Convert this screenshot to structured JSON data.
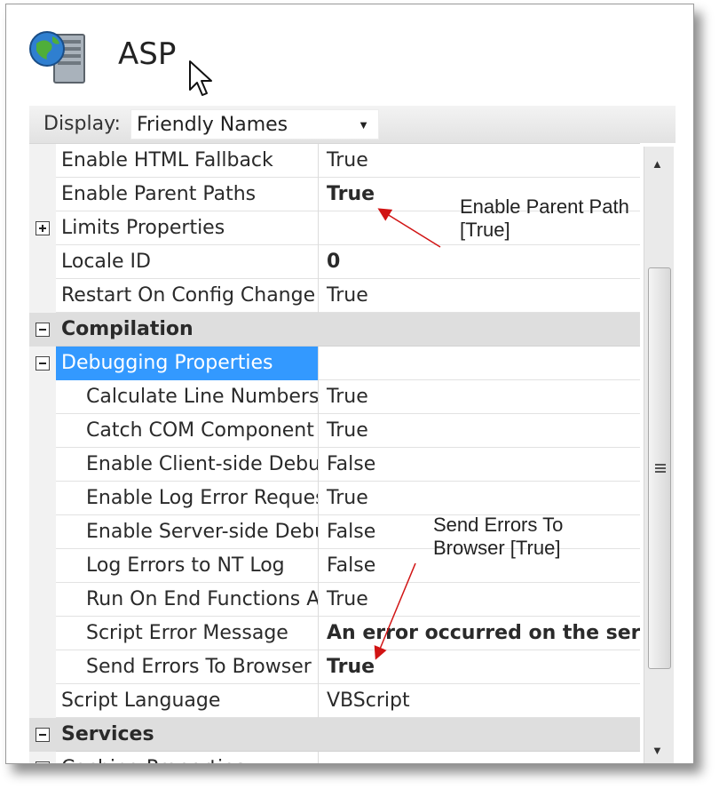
{
  "header": {
    "title": "ASP",
    "icon": "web-server-globe-icon"
  },
  "display": {
    "label": "Display:",
    "selected": "Friendly Names"
  },
  "rows": [
    {
      "name": "Enable HTML Fallback",
      "value": "True",
      "bold": false,
      "type": "property"
    },
    {
      "name": "Enable Parent Paths",
      "value": "True",
      "bold": true,
      "type": "property"
    },
    {
      "name": "Limits Properties",
      "value": "",
      "bold": false,
      "type": "group-collapsed"
    },
    {
      "name": "Locale ID",
      "value": "0",
      "bold": true,
      "type": "property"
    },
    {
      "name": "Restart On Config Change",
      "value": "True",
      "bold": false,
      "type": "property"
    },
    {
      "name": "Compilation",
      "value": "",
      "bold": false,
      "type": "category"
    },
    {
      "name": "Debugging Properties",
      "value": "",
      "bold": false,
      "type": "group-expanded-selected"
    },
    {
      "name": "Calculate Line Numbers",
      "value": "True",
      "bold": false,
      "type": "child"
    },
    {
      "name": "Catch COM Component",
      "value": "True",
      "bold": false,
      "type": "child"
    },
    {
      "name": "Enable Client-side Debug",
      "value": "False",
      "bold": false,
      "type": "child"
    },
    {
      "name": "Enable Log Error Request",
      "value": "True",
      "bold": false,
      "type": "child"
    },
    {
      "name": "Enable Server-side Debug",
      "value": "False",
      "bold": false,
      "type": "child"
    },
    {
      "name": "Log Errors to NT Log",
      "value": "False",
      "bold": false,
      "type": "child"
    },
    {
      "name": "Run On End Functions A",
      "value": "True",
      "bold": false,
      "type": "child"
    },
    {
      "name": "Script Error Message",
      "value": "An error occurred on the server",
      "bold": true,
      "type": "child"
    },
    {
      "name": "Send Errors To Browser",
      "value": "True",
      "bold": true,
      "type": "child"
    },
    {
      "name": "Script Language",
      "value": "VBScript",
      "bold": false,
      "type": "property"
    },
    {
      "name": "Services",
      "value": "",
      "bold": false,
      "type": "category"
    },
    {
      "name": "Caching Properties",
      "value": "",
      "bold": false,
      "type": "group-collapsed"
    }
  ],
  "annotations": {
    "parent_path": {
      "line1": "Enable Parent Path",
      "line2": "[True]"
    },
    "send_errors": {
      "line1": "Send Errors To",
      "line2": "Browser [True]"
    },
    "arrow_color": "#d11414"
  },
  "colors": {
    "selection": "#3399ff",
    "category_bg": "#dedede"
  },
  "scrollbar": {
    "icons": [
      "scroll-up-arrow-icon",
      "scroll-down-arrow-icon",
      "scroll-grip-icon"
    ]
  }
}
